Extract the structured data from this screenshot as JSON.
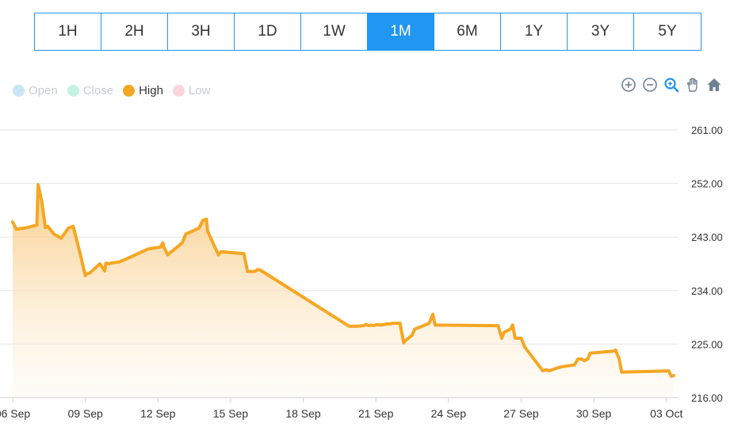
{
  "range_selector": {
    "buttons": [
      "1H",
      "2H",
      "3H",
      "1D",
      "1W",
      "1M",
      "6M",
      "1Y",
      "3Y",
      "5Y"
    ],
    "active": "1M",
    "active_color": "#2196f3"
  },
  "toolbar": {
    "icons": [
      "zoom-in-icon",
      "zoom-out-icon",
      "selection-zoom-icon",
      "pan-hand-icon",
      "home-reset-icon"
    ]
  },
  "chart_data": {
    "type": "area",
    "legend": [
      {
        "name": "Open",
        "color": "#c9e4f7",
        "active": false
      },
      {
        "name": "Close",
        "color": "#c6f2e3",
        "active": false
      },
      {
        "name": "High",
        "color": "#f5a623",
        "active": true
      },
      {
        "name": "Low",
        "color": "#fcd5da",
        "active": false
      }
    ],
    "legend_position": "top-left",
    "x_tick_labels": [
      "06 Sep",
      "09 Sep",
      "12 Sep",
      "15 Sep",
      "18 Sep",
      "21 Sep",
      "24 Sep",
      "27 Sep",
      "30 Sep",
      "03 Oct"
    ],
    "x_range_days": [
      0,
      27.5
    ],
    "y_ticks": [
      216,
      225,
      234,
      243,
      252,
      261
    ],
    "y_tick_labels": [
      "216.00",
      "225.00",
      "234.00",
      "243.00",
      "252.00",
      "261.00"
    ],
    "ylim": [
      216,
      261
    ],
    "y_axis_side": "right",
    "grid": "horizontal",
    "series": [
      {
        "name": "High",
        "color": "#f5a623",
        "x": [
          0,
          0.15,
          0.5,
          1.0,
          1.05,
          1.2,
          1.35,
          1.45,
          1.7,
          2.0,
          2.3,
          2.5,
          2.8,
          3.0,
          3.05,
          3.2,
          3.6,
          3.8,
          3.85,
          4.0,
          4.05,
          4.4,
          4.8,
          5.6,
          6.1,
          6.2,
          6.25,
          6.4,
          6.7,
          6.85,
          7.0,
          7.15,
          7.7,
          7.85,
          8.0,
          8.05,
          8.5,
          8.6,
          8.7,
          9.55,
          9.7,
          10.0,
          10.1,
          10.2,
          13.9,
          14.0,
          14.2,
          14.5,
          14.6,
          14.7,
          14.8,
          14.9,
          15.05,
          15.2,
          15.5,
          15.6,
          15.7,
          16.0,
          16.15,
          16.2,
          16.5,
          16.6,
          17.2,
          17.35,
          17.45,
          20.05,
          20.2,
          20.3,
          20.55,
          20.65,
          20.75,
          20.85,
          21.0,
          21.15,
          21.9,
          22.05,
          22.15,
          22.5,
          22.7,
          23.2,
          23.35,
          23.5,
          23.6,
          23.75,
          23.85,
          24.8,
          24.9,
          25.05,
          25.15,
          27.1,
          27.2,
          27.3
        ],
        "values": [
          245.5,
          244.3,
          244.5,
          245,
          251.8,
          249,
          244.6,
          244.8,
          243.5,
          242.8,
          244.5,
          244.8,
          240,
          236.5,
          236.8,
          237,
          238.5,
          237.3,
          238.6,
          238.5,
          238.6,
          238.8,
          239.5,
          241,
          241.3,
          242,
          241.3,
          240,
          241,
          241.5,
          242,
          243.5,
          244.5,
          245.8,
          246,
          244,
          240,
          240.5,
          240.5,
          240.2,
          237.2,
          237.2,
          237.5,
          237.5,
          228,
          228,
          228,
          228.1,
          228.3,
          228.1,
          228.2,
          228.1,
          228.3,
          228.2,
          228.4,
          228.4,
          228.5,
          228.5,
          225.2,
          225.5,
          226.5,
          227.5,
          228.5,
          230,
          228.2,
          228.1,
          226,
          227,
          227.5,
          228.2,
          226,
          226,
          226,
          224.5,
          220.5,
          220.7,
          220.5,
          221,
          221.2,
          221.5,
          222.5,
          222.5,
          222.2,
          222.5,
          223.5,
          223.8,
          224,
          222.5,
          220.3,
          220.5,
          219.6,
          219.7
        ]
      }
    ]
  }
}
